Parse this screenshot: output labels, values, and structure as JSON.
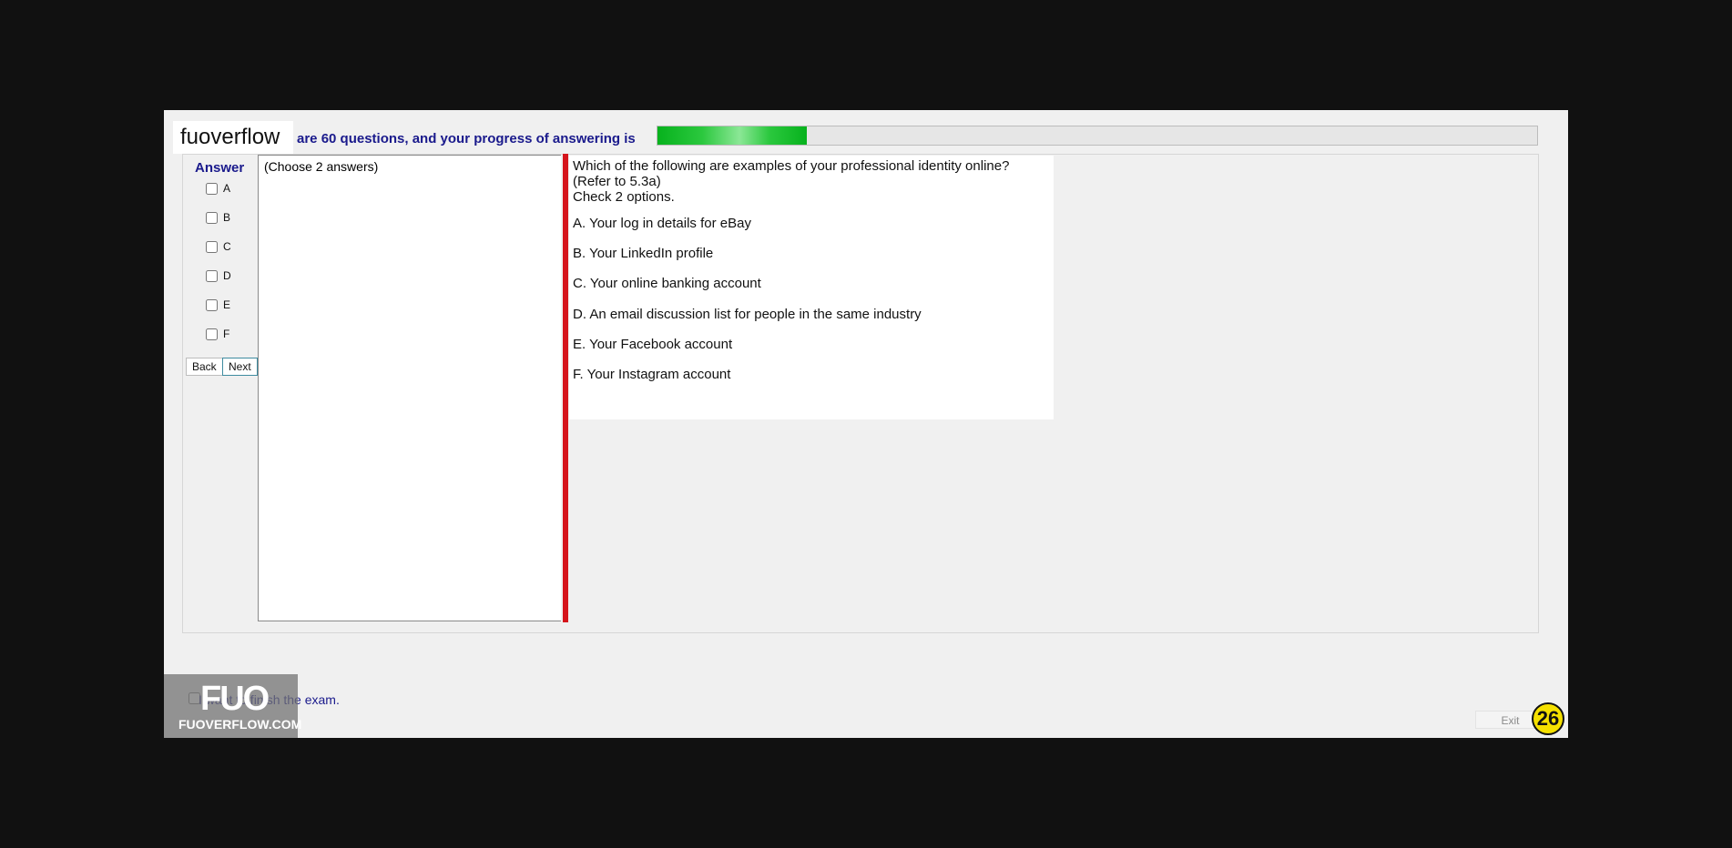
{
  "header": {
    "brand": "fuoverflow",
    "progress_text": "are 60 questions, and your progress of answering is",
    "progress_fraction": 0.17
  },
  "answer_panel": {
    "title": "Answer",
    "options": [
      "A",
      "B",
      "C",
      "D",
      "E",
      "F"
    ],
    "back_label": "Back",
    "next_label": "Next"
  },
  "notes": {
    "text": "(Choose 2 answers)"
  },
  "question": {
    "lines": [
      "Which of the following are examples of your professional identity online?",
      "(Refer to 5.3a)",
      "Check 2 options."
    ],
    "choices": [
      "A.  Your log in details for eBay",
      "B.  Your LinkedIn profile",
      "C.  Your online banking account",
      "D.  An email discussion list for people in the same industry",
      "E.  Your Facebook account",
      "F.  Your Instagram account"
    ]
  },
  "footer": {
    "finish_text": "I want to finish the exam.",
    "fuo_logo": "FUO",
    "fuo_url": "FUOVERFLOW.COM",
    "exit_label": "Exit",
    "page_number": "26"
  },
  "colors": {
    "progress_green": "#07b21d",
    "accent_red": "#d5141b",
    "label_blue": "#1a1a8c",
    "badge_yellow": "#f5e000"
  }
}
